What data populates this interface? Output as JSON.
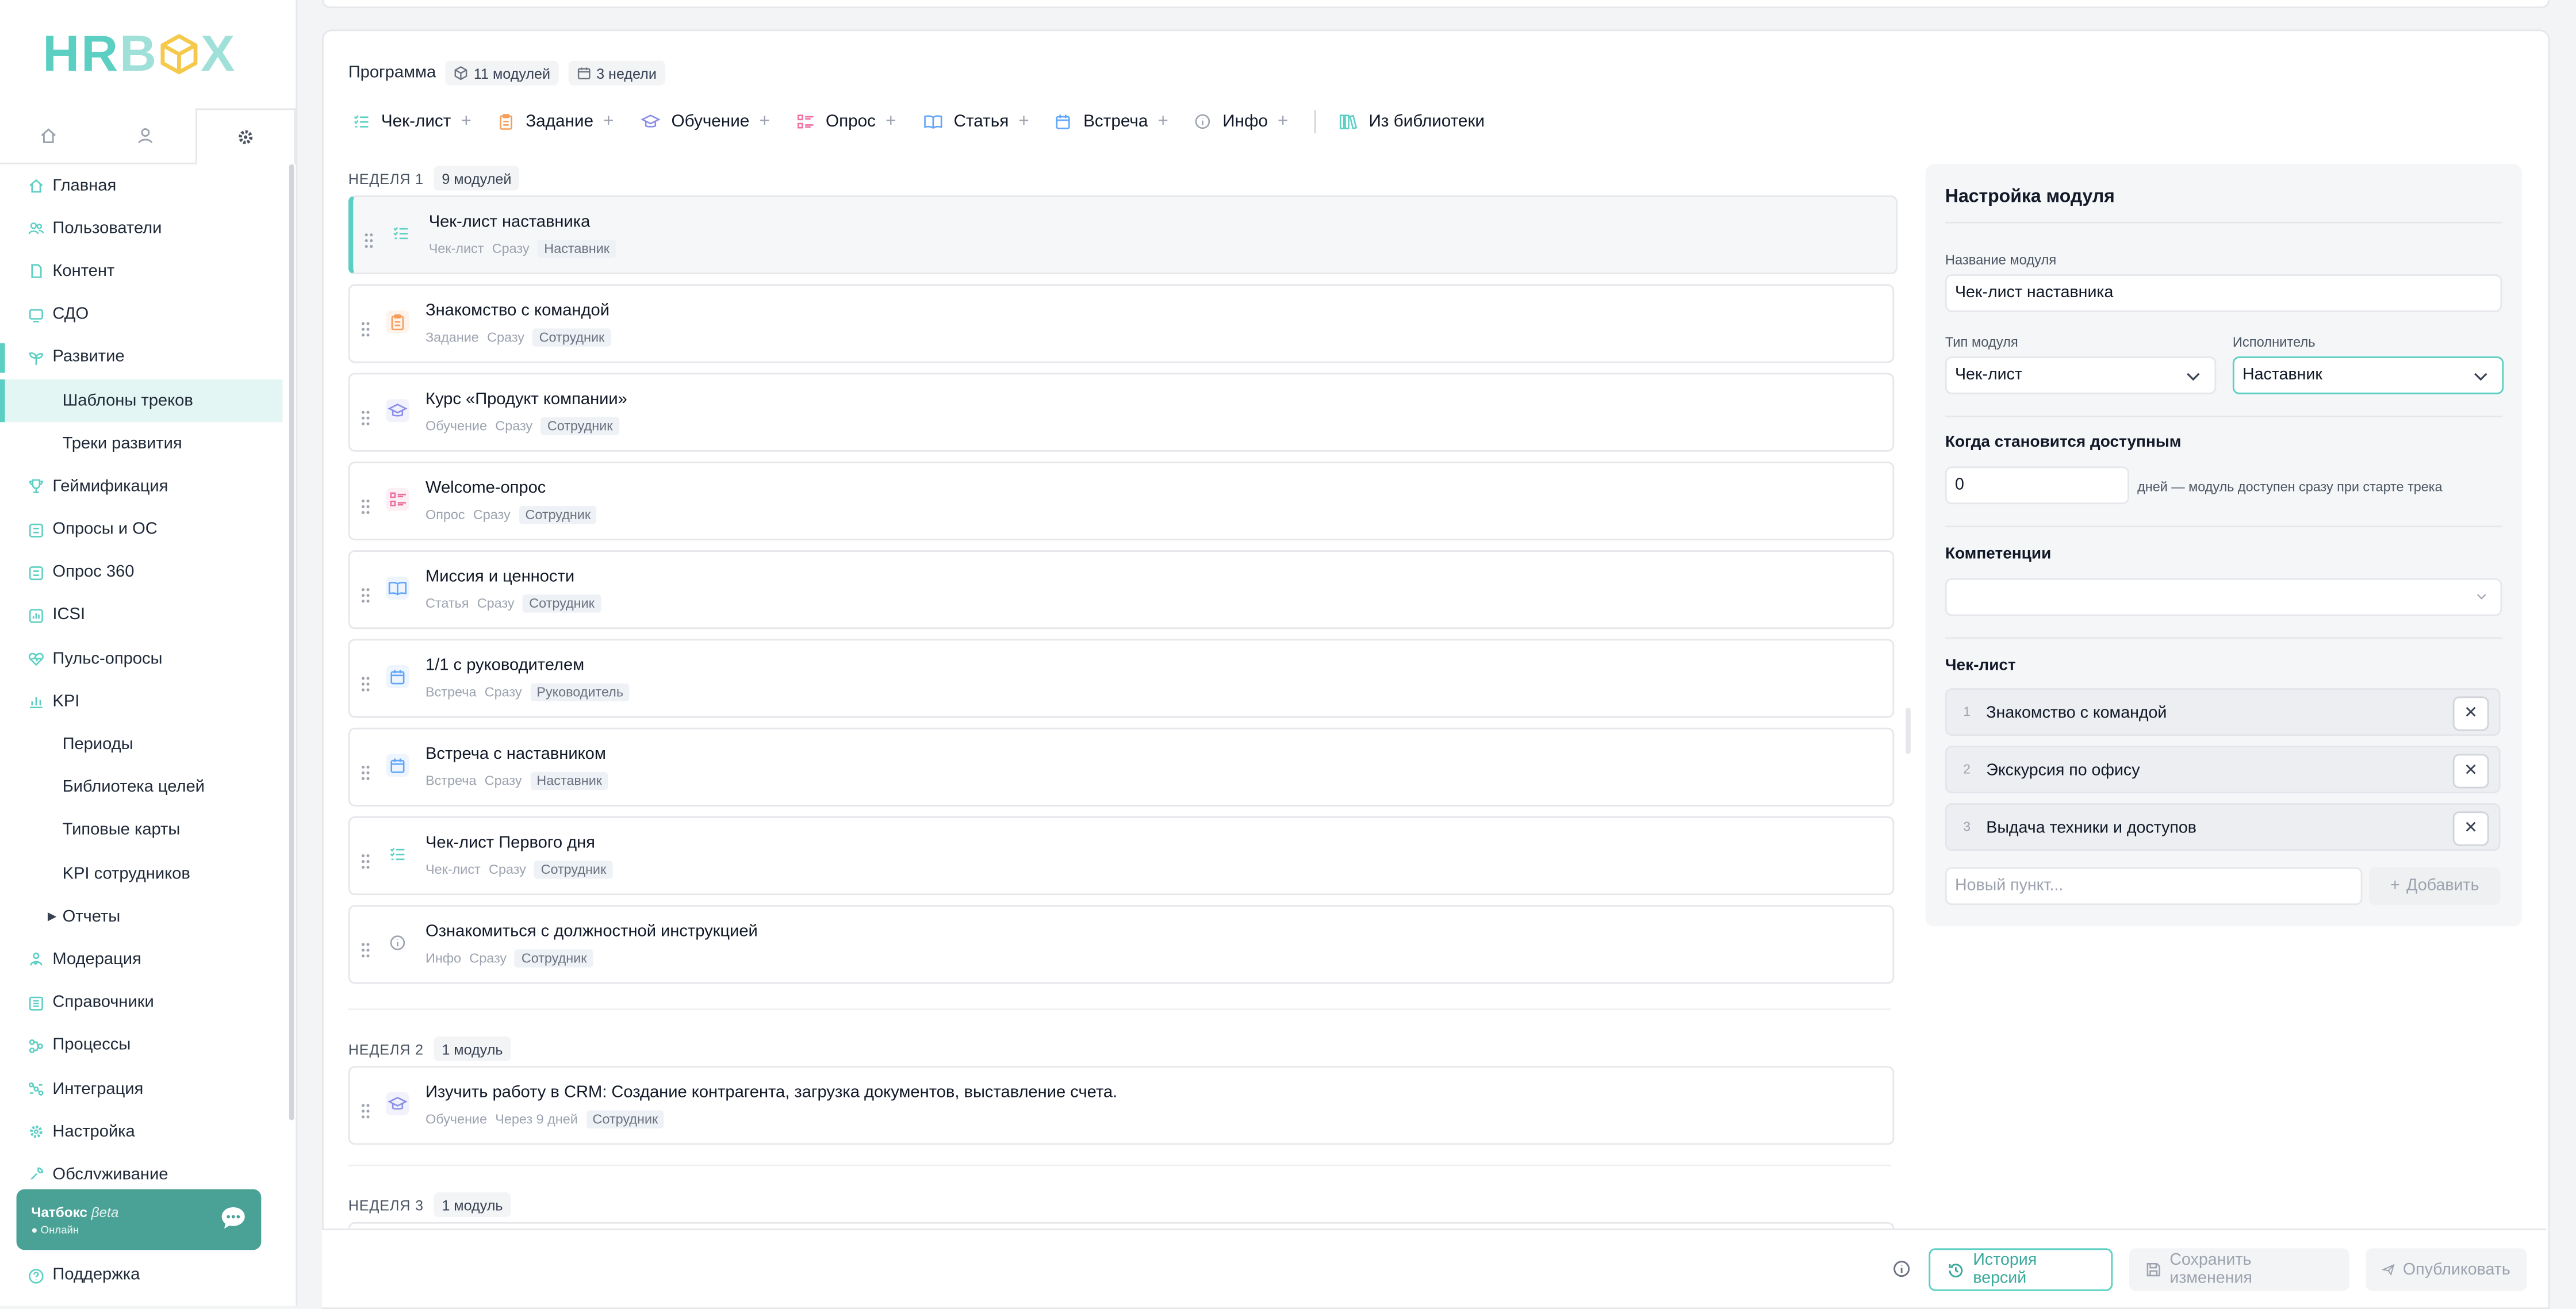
{
  "app": {
    "logo": "HRBOX"
  },
  "sidebar": {
    "tabs": [
      {
        "icon": "home-icon"
      },
      {
        "icon": "user-icon"
      },
      {
        "icon": "gear-icon"
      }
    ],
    "nav": {
      "glavnaya": "Главная",
      "users": "Пользователи",
      "content": "Контент",
      "sdo": "СДО",
      "razvitie": "Развитие",
      "shablony": "Шаблоны треков",
      "treki": "Треки развития",
      "gamification": "Геймификация",
      "surveys": "Опросы и ОС",
      "opros360": "Опрос 360",
      "icsi": "ICSI",
      "pulse": "Пульс-опросы",
      "kpi": "KPI",
      "periods": "Периоды",
      "goals": "Библиотека целей",
      "cards": "Типовые карты",
      "kpi_employees": "KPI сотрудников",
      "reports": "Отчеты",
      "moderation": "Модерация",
      "references": "Справочники",
      "processes": "Процессы",
      "integration": "Интеграция",
      "settings": "Настройка",
      "service": "Обслуживание"
    },
    "chatbox": {
      "title": "Чатбокс",
      "beta": "βeta",
      "status": "● Онлайн"
    },
    "support": "Поддержка"
  },
  "program": {
    "label": "Программа",
    "modules_count": "11 модулей",
    "weeks_count": "3 недели"
  },
  "toolbar": {
    "checklist": "Чек-лист",
    "task": "Задание",
    "training": "Обучение",
    "survey": "Опрос",
    "article": "Статья",
    "meeting": "Встреча",
    "info": "Инфо",
    "library": "Из библиотеки"
  },
  "weeks": {
    "w1": {
      "label": "НЕДЕЛЯ 1",
      "count": "9 модулей"
    },
    "w2": {
      "label": "НЕДЕЛЯ 2",
      "count": "1 модуль"
    },
    "w3": {
      "label": "НЕДЕЛЯ 3",
      "count": "1 модуль"
    }
  },
  "modules": [
    {
      "title": "Чек-лист наставника",
      "type": "Чек-лист",
      "when": "Сразу",
      "assignee": "Наставник",
      "icon": "checklist-icon",
      "color": "#5ccfc3"
    },
    {
      "title": "Знакомство с командой",
      "type": "Задание",
      "when": "Сразу",
      "assignee": "Сотрудник",
      "icon": "clipboard-icon",
      "color": "#f59e5b"
    },
    {
      "title": "Курс «Продукт компании»",
      "type": "Обучение",
      "when": "Сразу",
      "assignee": "Сотрудник",
      "icon": "graduation-cap-icon",
      "color": "#8b8ee8"
    },
    {
      "title": "Welcome-опрос",
      "type": "Опрос",
      "when": "Сразу",
      "assignee": "Сотрудник",
      "icon": "survey-icon",
      "color": "#ec6fa0"
    },
    {
      "title": "Миссия и ценности",
      "type": "Статья",
      "when": "Сразу",
      "assignee": "Сотрудник",
      "icon": "book-icon",
      "color": "#60a5fa"
    },
    {
      "title": "1/1 с руководителем",
      "type": "Встреча",
      "when": "Сразу",
      "assignee": "Руководитель",
      "icon": "calendar-icon",
      "color": "#60a5fa"
    },
    {
      "title": "Встреча с наставником",
      "type": "Встреча",
      "when": "Сразу",
      "assignee": "Наставник",
      "icon": "calendar-icon",
      "color": "#60a5fa"
    },
    {
      "title": "Чек-лист Первого дня",
      "type": "Чек-лист",
      "when": "Сразу",
      "assignee": "Сотрудник",
      "icon": "checklist-icon",
      "color": "#5ccfc3"
    },
    {
      "title": "Ознакомиться с должностной инструкцией",
      "type": "Инфо",
      "when": "Сразу",
      "assignee": "Сотрудник",
      "icon": "info-icon",
      "color": "#9ca3af"
    },
    {
      "title": "Изучить работу в CRM: Создание контрагента, загрузка документов, выставление счета.",
      "type": "Обучение",
      "when": "Через 9 дней",
      "assignee": "Сотрудник",
      "icon": "graduation-cap-icon",
      "color": "#8b8ee8"
    }
  ],
  "panel": {
    "title": "Настройка модуля",
    "name_label": "Название модуля",
    "name_value": "Чек-лист наставника",
    "type_label": "Тип модуля",
    "type_value": "Чек-лист",
    "assignee_label": "Исполнитель",
    "assignee_value": "Наставник",
    "available_title": "Когда становится доступным",
    "days_value": "0",
    "days_hint": "дней — модуль доступен сразу при старте трека",
    "competencies_title": "Компетенции",
    "checklist_title": "Чек-лист",
    "checklist": [
      {
        "num": "1",
        "text": "Знакомство с командой"
      },
      {
        "num": "2",
        "text": "Экскурсия по офису"
      },
      {
        "num": "3",
        "text": "Выдача техники и доступов"
      }
    ],
    "new_item_placeholder": "Новый пункт...",
    "add_label": "Добавить"
  },
  "footer": {
    "history": "История версий",
    "save": "Сохранить изменения",
    "publish": "Опубликовать"
  },
  "colors": {
    "accent": "#5ccfc3",
    "chatbox": "#4aa195"
  }
}
